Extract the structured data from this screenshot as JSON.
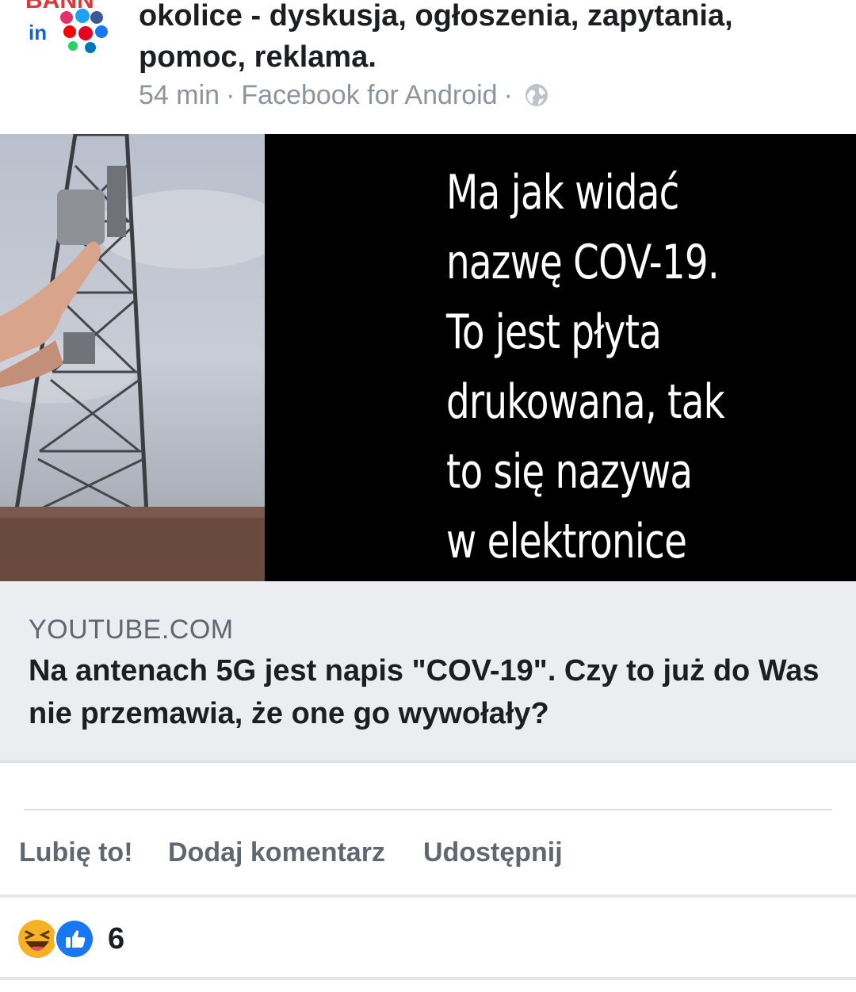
{
  "post": {
    "group_title": "okolice - dyskusja, ogłoszenia, zapytania, pomoc, reklama.",
    "time": "54 min",
    "separator": "·",
    "source": "Facebook for Android",
    "avatar_text": "BANN"
  },
  "media": {
    "overlay_lines": [
      "Ma jak widać",
      "nazwę COV-19.",
      "To jest płyta",
      "drukowana, tak",
      "to się nazywa",
      "w elektronice"
    ]
  },
  "link": {
    "domain": "YOUTUBE.COM",
    "title": "Na antenach 5G jest napis \"COV-19\". Czy to już do Was nie przemawia, że one go wywołały?"
  },
  "actions": {
    "like": "Lubię to!",
    "comment": "Dodaj komentarz",
    "share": "Udostępnij"
  },
  "reactions": {
    "icons": [
      "haha-icon",
      "like-icon"
    ],
    "count": "6",
    "colors": {
      "haha": "#f7b125",
      "like": "#1877f2"
    }
  }
}
